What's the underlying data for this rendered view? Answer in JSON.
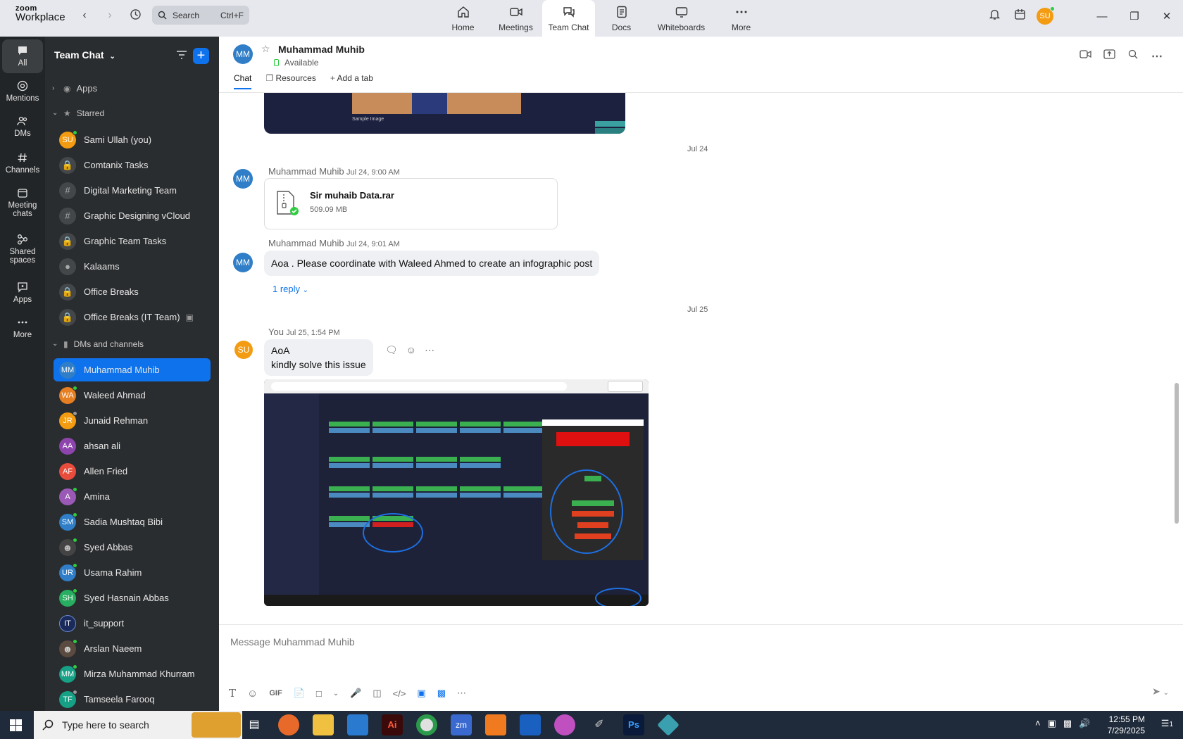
{
  "topbar": {
    "logo_line1": "zoom",
    "logo_line2": "Workplace",
    "search_placeholder": "Search",
    "search_shortcut": "Ctrl+F",
    "tabs": [
      {
        "label": "Home",
        "icon": "home-icon"
      },
      {
        "label": "Meetings",
        "icon": "video-icon"
      },
      {
        "label": "Team Chat",
        "icon": "chat-icon",
        "active": true
      },
      {
        "label": "Docs",
        "icon": "doc-icon"
      },
      {
        "label": "Whiteboards",
        "icon": "whiteboard-icon"
      },
      {
        "label": "More",
        "icon": "more-icon"
      }
    ],
    "user_initials": "SU"
  },
  "rail": [
    {
      "label": "All",
      "icon": "chat-bubble-icon",
      "selected": true
    },
    {
      "label": "Mentions",
      "icon": "at-icon"
    },
    {
      "label": "DMs",
      "icon": "people-icon"
    },
    {
      "label": "Channels",
      "icon": "hash-icon"
    },
    {
      "label": "Meeting chats",
      "icon": "calendar-icon"
    },
    {
      "label": "Shared spaces",
      "icon": "nodes-icon"
    },
    {
      "label": "Apps",
      "icon": "apps-icon"
    },
    {
      "label": "More",
      "icon": "more-icon"
    }
  ],
  "sidebar": {
    "title": "Team Chat",
    "groups": {
      "apps": "Apps",
      "starred": "Starred",
      "dms": "DMs and channels"
    },
    "starred": [
      {
        "name": "Sami Ullah (you)",
        "initials": "SU",
        "color": "#f39c12",
        "status": "green"
      },
      {
        "name": "Comtanix Tasks",
        "icon": "lock"
      },
      {
        "name": "Digital Marketing Team",
        "icon": "hash"
      },
      {
        "name": "Graphic Designing vCloud",
        "icon": "hash"
      },
      {
        "name": "Graphic Team Tasks",
        "icon": "lock"
      },
      {
        "name": "Kalaams",
        "icon": "people"
      },
      {
        "name": "Office Breaks",
        "icon": "lock"
      },
      {
        "name": "Office Breaks (IT Team)",
        "icon": "lock"
      }
    ],
    "dms": [
      {
        "name": "Muhammad Muhib",
        "initials": "MM",
        "color": "#2f7ec7",
        "selected": true
      },
      {
        "name": "Waleed Ahmad",
        "initials": "WA",
        "color": "#e67e22",
        "status": "green"
      },
      {
        "name": "Junaid Rehman",
        "initials": "JR",
        "color": "#f39c12",
        "status": "grey"
      },
      {
        "name": "ahsan ali",
        "initials": "AA",
        "color": "#8e44ad"
      },
      {
        "name": "Allen Fried",
        "initials": "AF",
        "color": "#e74c3c"
      },
      {
        "name": "Amina",
        "initials": "A",
        "color": "#9b59b6",
        "status": "green"
      },
      {
        "name": "Sadia Mushtaq Bibi",
        "initials": "SM",
        "color": "#2f7ec7",
        "status": "green"
      },
      {
        "name": "Syed Abbas",
        "initials": "",
        "color": "#333",
        "status": "green"
      },
      {
        "name": "Usama Rahim",
        "initials": "UR",
        "color": "#2f7ec7",
        "status": "green"
      },
      {
        "name": "Syed Hasnain Abbas",
        "initials": "SH",
        "color": "#27ae60",
        "status": "green"
      },
      {
        "name": "it_support",
        "initials": "IT",
        "color": "#1a2a5a"
      },
      {
        "name": "Arslan Naeem",
        "initials": "",
        "color": "#555",
        "status": "green"
      },
      {
        "name": "Mirza Muhammad Khurram",
        "initials": "MM",
        "color": "#16a085",
        "status": "green"
      },
      {
        "name": "Tamseela Farooq",
        "initials": "TF",
        "color": "#16a085",
        "status": "grey"
      }
    ]
  },
  "chat": {
    "contact_name": "Muhammad Muhib",
    "contact_initials": "MM",
    "status": "Available",
    "tabs": [
      "Chat",
      "Resources",
      "Add a tab"
    ],
    "date1": "Jul 24",
    "msg1_sender": "Muhammad Muhib",
    "msg1_time": "Jul 24, 9:00 AM",
    "file_name": "Sir muhaib Data.rar",
    "file_size": "509.09 MB",
    "msg2_sender": "Muhammad Muhib",
    "msg2_time": "Jul 24, 9:01 AM",
    "msg2_text": "Aoa . Please coordinate with Waleed Ahmed to create an infographic post",
    "msg2_replies": "1 reply",
    "date2": "Jul 25",
    "msg3_sender": "You",
    "msg3_time": "Jul 25, 1:54 PM",
    "msg3_line1": "AoA",
    "msg3_line2": "kindly solve this issue",
    "my_initials": "SU",
    "top_image_caption": "Sample Image"
  },
  "composer": {
    "placeholder": "Message Muhammad Muhib",
    "gif_label": "GIF"
  },
  "taskbar": {
    "search_placeholder": "Type here to search",
    "time": "12:55 PM",
    "date": "7/29/2025",
    "notif_count": "1"
  },
  "colors": {
    "accent": "#0e72ed",
    "sidebar_bg": "#2a2d2f",
    "rail_bg": "#222527",
    "status_green": "#2ecc40"
  }
}
